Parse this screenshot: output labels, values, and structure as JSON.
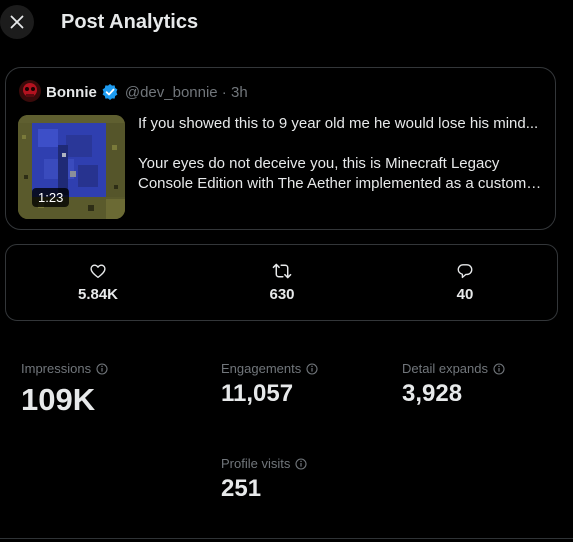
{
  "header": {
    "title": "Post Analytics"
  },
  "quoted_post": {
    "author_name": "Bonnie",
    "author_meta": "@dev_bonnie · 3h",
    "video_duration": "1:23",
    "text_line1": "If you showed this to 9 year old me he would lose his mind...",
    "text_line2": "Your eyes do not deceive you, this is Minecraft Legacy Console Edition with The Aether implemented as a custom dimension..."
  },
  "engagement_bar": {
    "likes": "5.84K",
    "reposts": "630",
    "replies": "40"
  },
  "stats": {
    "impressions_label": "Impressions",
    "impressions_value": "109K",
    "engagements_label": "Engagements",
    "engagements_value": "11,057",
    "detail_expands_label": "Detail expands",
    "detail_expands_value": "3,928",
    "profile_visits_label": "Profile visits",
    "profile_visits_value": "251"
  },
  "icons": {
    "close": "close-icon",
    "verified": "verified-badge-icon",
    "like": "heart-icon",
    "repost": "repost-icon",
    "reply": "reply-icon",
    "info": "info-icon"
  },
  "colors": {
    "background": "#000000",
    "text_primary": "#e7e9ea",
    "text_secondary": "#71767b",
    "border": "#333639",
    "verified_blue": "#1d9bf0"
  }
}
